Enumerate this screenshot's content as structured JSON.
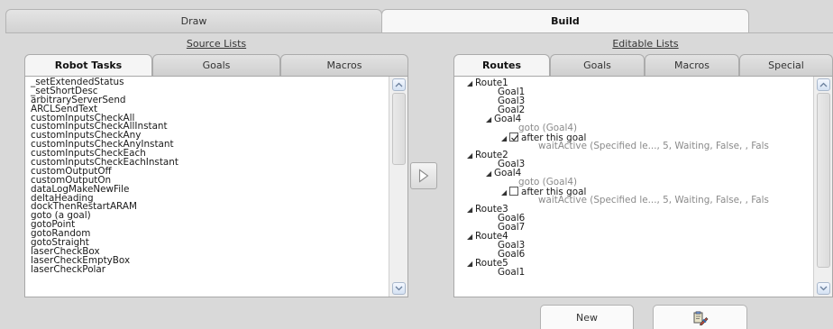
{
  "top_tabs": [
    {
      "label": "Draw"
    },
    {
      "label": "Build"
    }
  ],
  "left_section": {
    "heading": "Source Lists",
    "tabs": [
      {
        "label": "Robot Tasks"
      },
      {
        "label": "Goals"
      },
      {
        "label": "Macros"
      }
    ],
    "items": [
      "_setExtendedStatus",
      "_setShortDesc",
      "arbitraryServerSend",
      "ARCLSendText",
      "customInputsCheckAll",
      "customInputsCheckAllInstant",
      "customInputsCheckAny",
      "customInputsCheckAnyInstant",
      "customInputsCheckEach",
      "customInputsCheckEachInstant",
      "customOutputOff",
      "customOutputOn",
      "dataLogMakeNewFile",
      "deltaHeading",
      "dockThenRestartARAM",
      "goto (a goal)",
      "gotoPoint",
      "gotoRandom",
      "gotoStraight",
      "laserCheckBox",
      "laserCheckEmptyBox",
      "laserCheckPolar"
    ]
  },
  "right_section": {
    "heading": "Editable Lists",
    "tabs": [
      {
        "label": "Routes"
      },
      {
        "label": "Goals"
      },
      {
        "label": "Macros"
      },
      {
        "label": "Special"
      }
    ],
    "tree": {
      "route1": "Route1",
      "route1_goal1": "Goal1",
      "route1_goal3": "Goal3",
      "route1_goal2": "Goal2",
      "route1_goal4": "Goal4",
      "route1_goto": "goto (Goal4)",
      "route1_after": "after this goal",
      "route1_wait": "waitActive (Specified le..., 5, Waiting, False, , Fals",
      "route2": "Route2",
      "route2_goal3": "Goal3",
      "route2_goal4": "Goal4",
      "route2_goto": "goto (Goal4)",
      "route2_after": "after this goal",
      "route2_wait": "waitActive (Specified le..., 5, Waiting, False, , Fals",
      "route3": "Route3",
      "route3_goal6": "Goal6",
      "route3_goal7": "Goal7",
      "route4": "Route4",
      "route4_goal3": "Goal3",
      "route4_goal6": "Goal6",
      "route5": "Route5",
      "route5_goal1": "Goal1"
    }
  },
  "buttons": {
    "new_label": "New"
  },
  "colors": {
    "background": "#d9d9d9",
    "panel": "#ffffff",
    "scroll_button": "#d4e1f3"
  },
  "icons": {
    "transfer": "play-triangle-icon",
    "edit": "clipboard-edit-icon"
  }
}
